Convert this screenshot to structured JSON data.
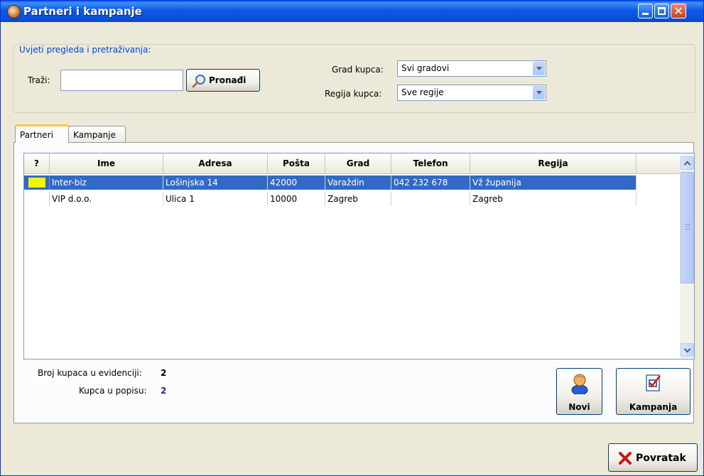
{
  "window": {
    "title": "Partneri i kampanje"
  },
  "filters": {
    "legend": "Uvjeti pregleda i pretraživanja:",
    "search_label": "Traži:",
    "search_value": "",
    "find_button": "Pronađi",
    "city_label": "Grad kupca:",
    "city_value": "Svi gradovi",
    "region_label": "Regija kupca:",
    "region_value": "Sve regije"
  },
  "tabs": [
    {
      "label": "Partneri",
      "active": true
    },
    {
      "label": "Kampanje",
      "active": false
    }
  ],
  "grid": {
    "columns": [
      "?",
      "Ime",
      "Adresa",
      "Pošta",
      "Grad",
      "Telefon",
      "Regija"
    ],
    "rows": [
      {
        "marker_color": "#f4f400",
        "ime": "Inter-biz",
        "adresa": "Lošinjska 14",
        "posta": "42000",
        "grad": "Varaždin",
        "telefon": "042 232 678",
        "regija": "Vž županija",
        "selected": true
      },
      {
        "marker_color": "",
        "ime": "VIP d.o.o.",
        "adresa": "Ulica 1",
        "posta": "10000",
        "grad": "Zagreb",
        "telefon": "",
        "regija": "Zagreb",
        "selected": false
      }
    ]
  },
  "stats": {
    "total_label": "Broj kupaca u evidenciji:",
    "total_value": "2",
    "listed_label": "Kupca u popisu:",
    "listed_value": "2",
    "listed_color": "#1c2d8c"
  },
  "actions": {
    "new_label": "Novi",
    "campaign_label": "Kampanja",
    "back_label": "Povratak"
  },
  "colors": {
    "selection": "#316ac5",
    "legend_text": "#0046d5",
    "close_x": "#c01818"
  },
  "icons": [
    "search-icon",
    "user-icon",
    "campaign-checklist-icon",
    "close-x-icon",
    "dropdown-arrow-icon",
    "scroll-up-icon",
    "scroll-down-icon"
  ]
}
